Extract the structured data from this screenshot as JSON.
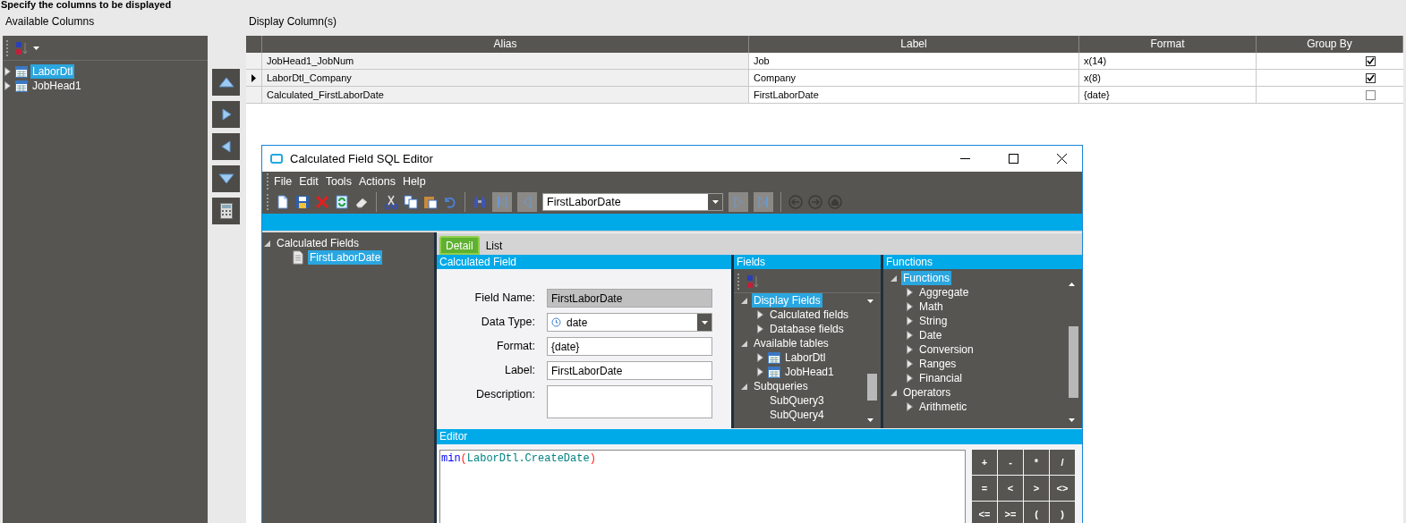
{
  "page_title": "Specify the columns to be displayed",
  "available_columns": {
    "label": "Available Columns",
    "tree": [
      {
        "label": "LaborDtl",
        "kind": "table",
        "expanded": false,
        "selected": true
      },
      {
        "label": "JobHead1",
        "kind": "table",
        "expanded": false,
        "selected": false
      }
    ]
  },
  "display_columns": {
    "label": "Display Column(s)",
    "columns": [
      "Alias",
      "Label",
      "Format",
      "Group By"
    ],
    "rows": [
      {
        "alias": "JobHead1_JobNum",
        "label": "Job",
        "format": "x(14)",
        "group_by": true,
        "current": false
      },
      {
        "alias": "LaborDtl_Company",
        "label": "Company",
        "format": "x(8)",
        "group_by": true,
        "current": true
      },
      {
        "alias": "Calculated_FirstLaborDate",
        "label": "FirstLaborDate",
        "format": "{date}",
        "group_by": false,
        "current": false
      }
    ]
  },
  "dialog": {
    "title": "Calculated Field SQL Editor",
    "menu": [
      "File",
      "Edit",
      "Tools",
      "Actions",
      "Help"
    ],
    "record": "FirstLaborDate",
    "tree": [
      {
        "label": "Calculated Fields",
        "kind": "group",
        "expanded": true,
        "selected": false,
        "children": [
          {
            "label": "FirstLaborDate",
            "kind": "calc",
            "selected": true
          }
        ]
      }
    ],
    "tabs": [
      {
        "label": "Detail",
        "selected": true
      },
      {
        "label": "List",
        "selected": false
      }
    ],
    "calculated_field": {
      "header": "Calculated Field",
      "rows": [
        {
          "kind": "readonly",
          "label": "Field Name:",
          "value": "FirstLaborDate"
        },
        {
          "kind": "select",
          "label": "Data Type:",
          "value": "date"
        },
        {
          "kind": "text",
          "label": "Format:",
          "value": "{date}"
        },
        {
          "kind": "text",
          "label": "Label:",
          "value": "FirstLaborDate"
        },
        {
          "kind": "textarea",
          "label": "Description:"
        }
      ]
    },
    "fields": {
      "header": "Fields",
      "tree": [
        {
          "label": "Display Fields",
          "kind": "group",
          "expanded": true,
          "selected": true,
          "children": [
            {
              "label": "Calculated fields",
              "kind": "group",
              "expanded": false,
              "selected": false
            },
            {
              "label": "Database fields",
              "kind": "group",
              "expanded": false,
              "selected": false
            }
          ]
        },
        {
          "label": "Available tables",
          "kind": "group",
          "expanded": true,
          "selected": false,
          "children": [
            {
              "label": "LaborDtl",
              "kind": "table",
              "expanded": false,
              "selected": false
            },
            {
              "label": "JobHead1",
              "kind": "table",
              "expanded": false,
              "selected": false
            }
          ]
        },
        {
          "label": "Subqueries",
          "kind": "group",
          "expanded": true,
          "selected": false,
          "children": [
            {
              "label": "SubQuery3",
              "kind": "item",
              "selected": false
            },
            {
              "label": "SubQuery4",
              "kind": "item",
              "selected": false
            }
          ]
        }
      ]
    },
    "functions": {
      "header": "Functions",
      "tree": [
        {
          "label": "Functions",
          "kind": "group",
          "expanded": true,
          "selected": true,
          "children": [
            {
              "label": "Aggregate",
              "kind": "group",
              "expanded": false,
              "selected": false
            },
            {
              "label": "Math",
              "kind": "group",
              "expanded": false,
              "selected": false
            },
            {
              "label": "String",
              "kind": "group",
              "expanded": false,
              "selected": false
            },
            {
              "label": "Date",
              "kind": "group",
              "expanded": false,
              "selected": false
            },
            {
              "label": "Conversion",
              "kind": "group",
              "expanded": false,
              "selected": false
            },
            {
              "label": "Ranges",
              "kind": "group",
              "expanded": false,
              "selected": false
            },
            {
              "label": "Financial",
              "kind": "group",
              "expanded": false,
              "selected": false
            }
          ]
        },
        {
          "label": "Operators",
          "kind": "group",
          "expanded": true,
          "selected": false,
          "children": [
            {
              "label": "Arithmetic",
              "kind": "group",
              "expanded": false,
              "selected": false
            }
          ]
        }
      ]
    },
    "editor": {
      "header": "Editor",
      "code": [
        {
          "kind": "keyword",
          "text": "min"
        },
        {
          "kind": "paren",
          "text": "("
        },
        {
          "kind": "identifier",
          "text": "LaborDtl.CreateDate"
        },
        {
          "kind": "paren",
          "text": ")"
        }
      ],
      "keys": [
        "+",
        "-",
        "*",
        "/",
        "=",
        "<",
        ">",
        "<>",
        "<=",
        ">=",
        "(",
        ")"
      ]
    }
  }
}
